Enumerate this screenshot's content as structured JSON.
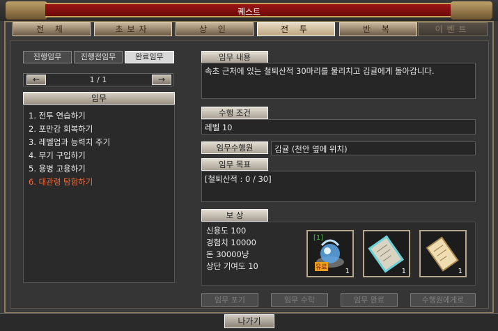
{
  "window": {
    "title": "퀘스트"
  },
  "tabs": [
    {
      "label": "전 체",
      "state": "normal"
    },
    {
      "label": "초보자",
      "state": "normal"
    },
    {
      "label": "상 인",
      "state": "normal"
    },
    {
      "label": "전 투",
      "state": "active"
    },
    {
      "label": "반 복",
      "state": "normal"
    },
    {
      "label": "이벤트",
      "state": "disabled"
    }
  ],
  "subtabs": [
    {
      "label": "진행임무",
      "active": false
    },
    {
      "label": "진행전임무",
      "active": false
    },
    {
      "label": "완료임무",
      "active": true
    }
  ],
  "pager": {
    "text": "1 / 1",
    "prev": "←",
    "next": "→"
  },
  "quest_list": {
    "header": "임무",
    "items": [
      {
        "label": "1. 전투 연습하기",
        "selected": false
      },
      {
        "label": "2. 포만감 회복하기",
        "selected": false
      },
      {
        "label": "3. 레벨업과 능력치 주기",
        "selected": false
      },
      {
        "label": "4. 무기 구입하기",
        "selected": false
      },
      {
        "label": "5. 용병 고용하기",
        "selected": false
      },
      {
        "label": "6. 대관령 탐험하기",
        "selected": true
      }
    ]
  },
  "details": {
    "content_label": "임무 내용",
    "content_text": "속초 근처에 있는 철퇴산적 30마리를 물리치고 김귤에게 돌아갑니다.",
    "condition_label": "수행 조건",
    "condition_text": "레벨 10",
    "npc_label": "임무수행원",
    "npc_text": "김귤 (천안 옆에 위치)",
    "goal_label": "임무 목표",
    "goal_text": "[철퇴산적 : 0 / 30]",
    "reward_label": "보 상",
    "rewards": [
      "신용도 100",
      "경험치 10000",
      "돈 30000냥",
      "상단 기여도 10"
    ],
    "reward_items": [
      {
        "icon": "magic-orb-item-icon",
        "count": "1",
        "tag": "[1]",
        "badge": "유료"
      },
      {
        "icon": "scroll-item-icon",
        "count": "1"
      },
      {
        "icon": "parchment-item-icon",
        "count": "1"
      }
    ]
  },
  "actions": [
    "임무 포기",
    "임무 수락",
    "임무 완료",
    "수행원에게로"
  ],
  "exit_label": "나가기"
}
